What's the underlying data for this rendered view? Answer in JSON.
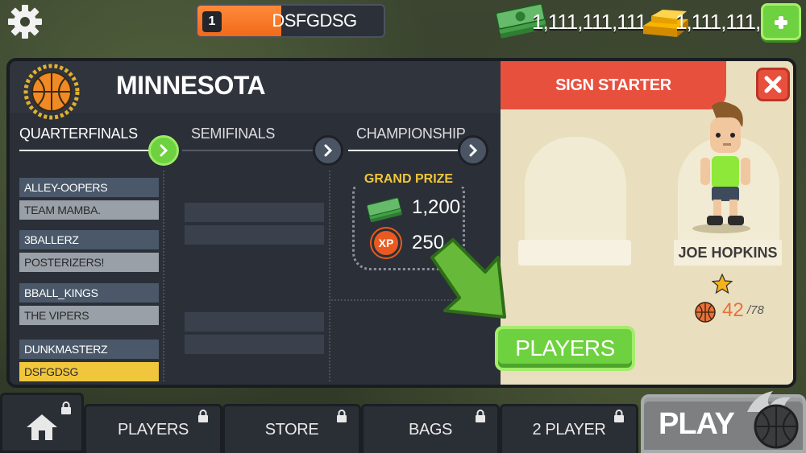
{
  "topbar": {
    "level": "1",
    "level_progress": 0.45,
    "player_name": "DSFGDSG",
    "cash": "1,111,111,111",
    "gold": "1,111,111,1",
    "icons": [
      "gear-icon",
      "cash-icon",
      "gold-icon",
      "plus-icon"
    ]
  },
  "tournament": {
    "team_name": "MINNESOTA",
    "rounds": [
      "QUARTERFINALS",
      "SEMIFINALS",
      "CHAMPIONSHIP"
    ],
    "quarterfinals": [
      {
        "top": "ALLEY-OOPERS",
        "bottom": "TEAM MAMBA."
      },
      {
        "top": "3BALLERZ",
        "bottom": "POSTERIZERS!"
      },
      {
        "top": "BBALL_KINGS",
        "bottom": "THE VIPERS"
      },
      {
        "top": "DUNKMASTERZ",
        "bottom": "DSFGDSG"
      }
    ],
    "grand_prize": {
      "title": "GRAND PRIZE",
      "cash": "1,200",
      "xp_label": "XP",
      "xp": "250"
    }
  },
  "roster": {
    "sign_label": "SIGN STARTER",
    "player_name": "JOE HOPKINS",
    "stars": 1,
    "rating": "42",
    "rating_max": "/78",
    "players_button": "PLAYERS"
  },
  "bottom_nav": {
    "items": [
      "PLAYERS",
      "STORE",
      "BAGS",
      "2 PLAYER"
    ],
    "play_label": "PLAY"
  },
  "colors": {
    "accent_green": "#6ed13f",
    "accent_red": "#e8503e",
    "progress_orange": "#f06a1a",
    "highlight_yellow": "#f0c63c"
  }
}
